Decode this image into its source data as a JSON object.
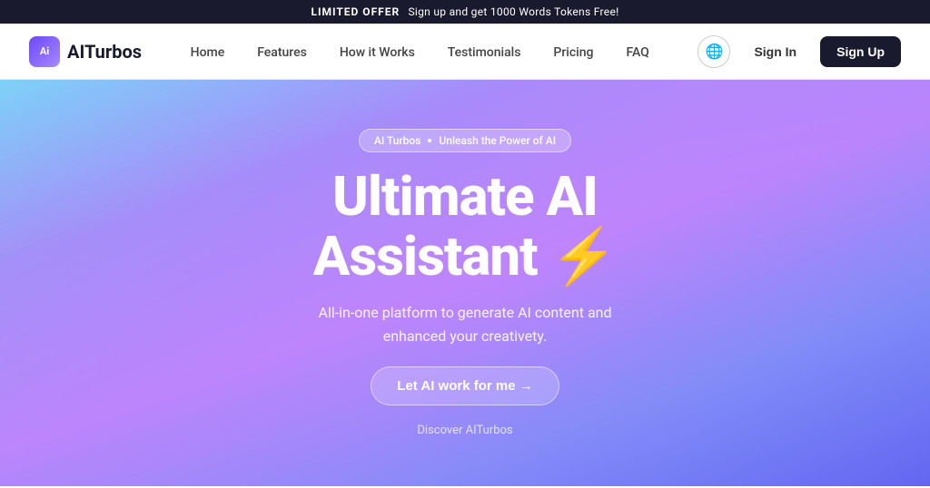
{
  "announcement": {
    "label": "LIMITED OFFER",
    "text": "Sign up and get 1000 Words Tokens Free!"
  },
  "navbar": {
    "logo_icon_text": "Ai",
    "logo_name": "AITurbos",
    "nav_links": [
      {
        "id": "home",
        "label": "Home"
      },
      {
        "id": "features",
        "label": "Features"
      },
      {
        "id": "how-it-works",
        "label": "How it Works"
      },
      {
        "id": "testimonials",
        "label": "Testimonials"
      },
      {
        "id": "pricing",
        "label": "Pricing"
      },
      {
        "id": "faq",
        "label": "FAQ"
      }
    ],
    "signin_label": "Sign In",
    "signup_label": "Sign Up",
    "globe_icon": "🌐"
  },
  "hero": {
    "badge_text": "AI Turbos",
    "badge_tagline": "Unleash the Power of AI",
    "title_line1": "Ultimate AI",
    "title_line2": "Assistant ⚡",
    "subtitle": "All-in-one platform to generate AI content and enhanced your creativety.",
    "cta_label": "Let AI work for me →",
    "discover_label": "Discover AITurbos"
  }
}
